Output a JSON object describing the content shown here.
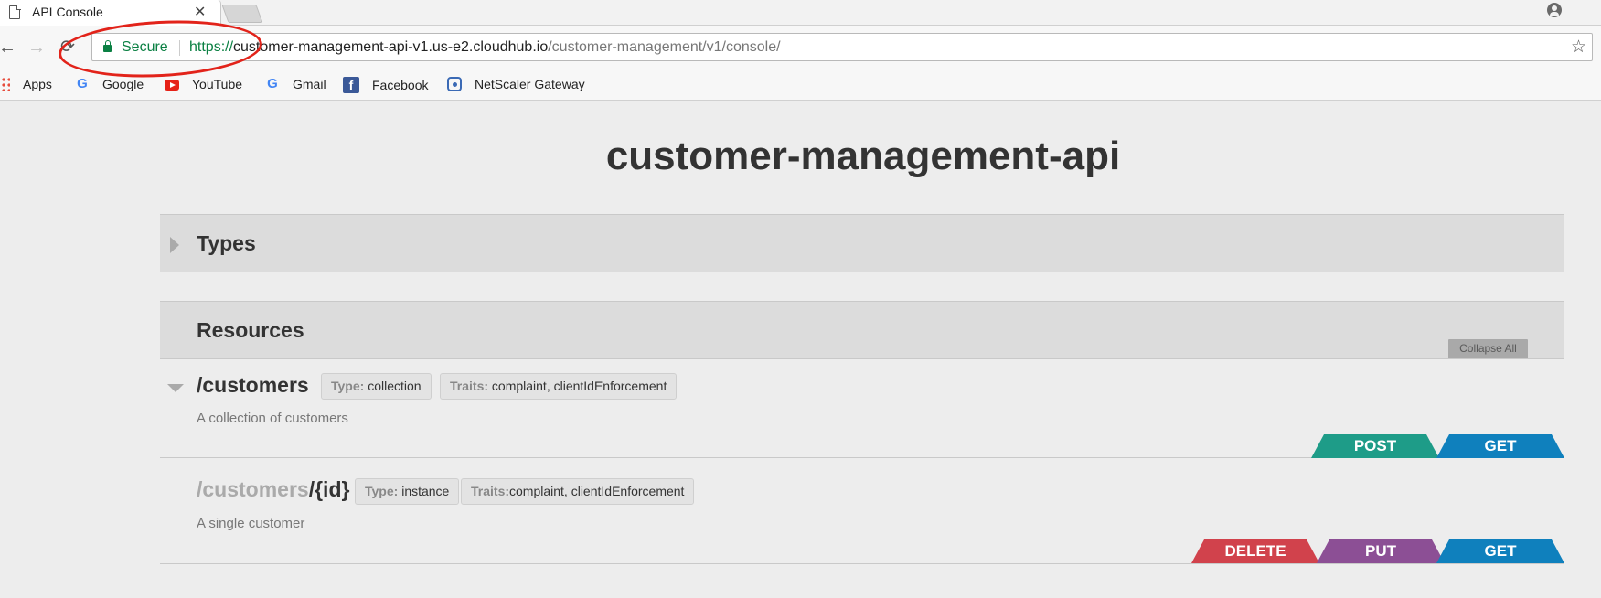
{
  "browser": {
    "tab_title": "API Console",
    "tab_close": "✕",
    "nav": {
      "back": "←",
      "forward": "→",
      "reload": "⟳"
    },
    "omnibox": {
      "secure_label": "Secure",
      "url_scheme": "https://",
      "url_host": "customer-management-api-v1.us-e2.cloudhub.io",
      "url_path": "/customer-management/v1/console/"
    },
    "bookmarks": [
      {
        "label": "Apps",
        "icon": "apps-grid-icon"
      },
      {
        "label": "Google",
        "icon": "google-icon"
      },
      {
        "label": "YouTube",
        "icon": "youtube-icon"
      },
      {
        "label": "Gmail",
        "icon": "google-icon"
      },
      {
        "label": "Facebook",
        "icon": "facebook-icon"
      },
      {
        "label": "NetScaler Gateway",
        "icon": "netscaler-icon"
      }
    ]
  },
  "page": {
    "title": "customer-management-api",
    "types_label": "Types",
    "resources_label": "Resources",
    "collapse_all": "Collapse All",
    "resources": [
      {
        "path_prefix": "",
        "path": "/customers",
        "type_key": "Type:",
        "type_value": "collection",
        "traits_key": "Traits:",
        "traits_value": "complaint, clientIdEnforcement",
        "description": "A collection of customers",
        "methods": [
          "POST",
          "GET"
        ]
      },
      {
        "path_prefix": "/customers",
        "path": "/{id}",
        "type_key": "Type:",
        "type_value": "instance",
        "traits_key": "Traits:",
        "traits_value": "complaint, clientIdEnforcement",
        "description": "A single customer",
        "methods": [
          "DELETE",
          "PUT",
          "GET"
        ]
      }
    ]
  },
  "colors": {
    "post": "#1e9c88",
    "get": "#0f80bd",
    "delete": "#d1424c",
    "put": "#8c4f95",
    "secure_green": "#0b8043",
    "annotation_red": "#e2231a"
  }
}
